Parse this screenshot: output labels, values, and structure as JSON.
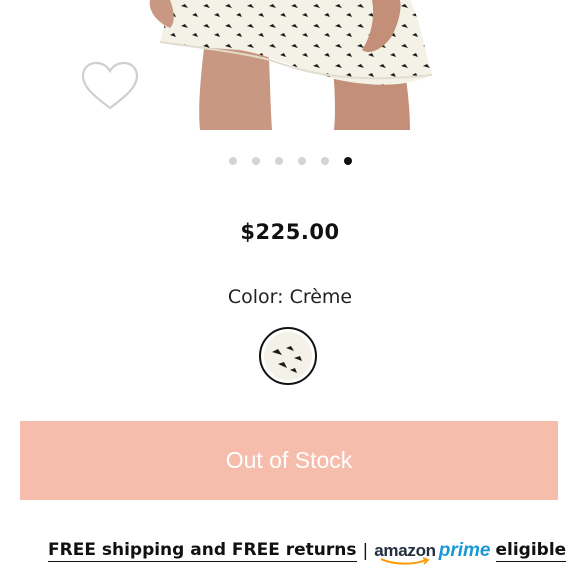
{
  "product": {
    "price": "$225.00",
    "color_label": "Color: Crème",
    "selected_color": "Crème",
    "carousel": {
      "total": 6,
      "active_index": 5
    },
    "in_stock": false
  },
  "actions": {
    "oos_label": "Out of Stock"
  },
  "shipping": {
    "free_text": "FREE shipping and FREE returns",
    "separator": "|",
    "amazon": "amazon",
    "prime": "prime",
    "eligible": "eligible"
  },
  "colors": {
    "oos_button_bg": "#f6bdad",
    "prime_blue": "#1a98d6",
    "active_dot": "#111111",
    "inactive_dot": "#d4d4d4"
  },
  "icons": [
    "heart-icon",
    "amazon-prime-logo"
  ]
}
